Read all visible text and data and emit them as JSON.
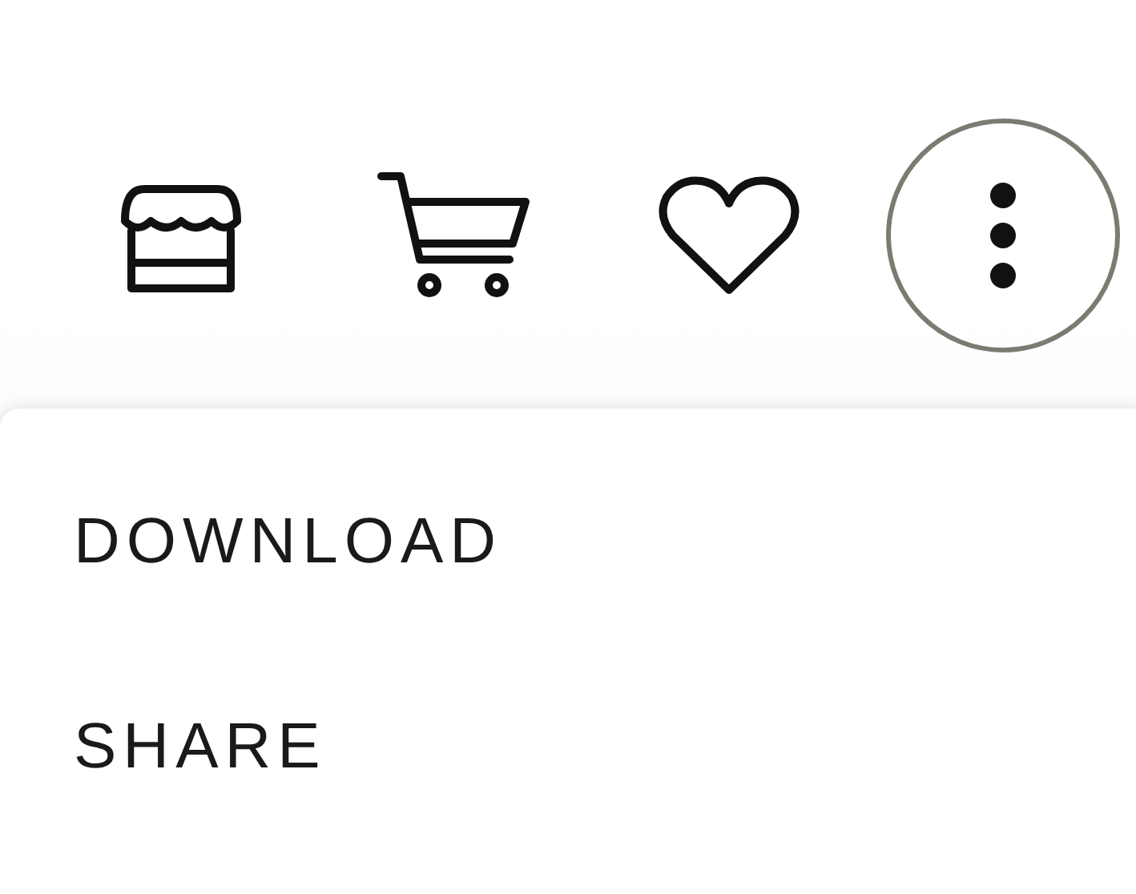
{
  "toolbar": [
    {
      "kind": "shop",
      "active": false
    },
    {
      "kind": "cart",
      "active": false
    },
    {
      "kind": "heart",
      "active": false
    },
    {
      "kind": "more",
      "active": true
    }
  ],
  "menu": {
    "items": [
      {
        "label": "DOWNLOAD"
      },
      {
        "label": "SHARE"
      }
    ]
  }
}
